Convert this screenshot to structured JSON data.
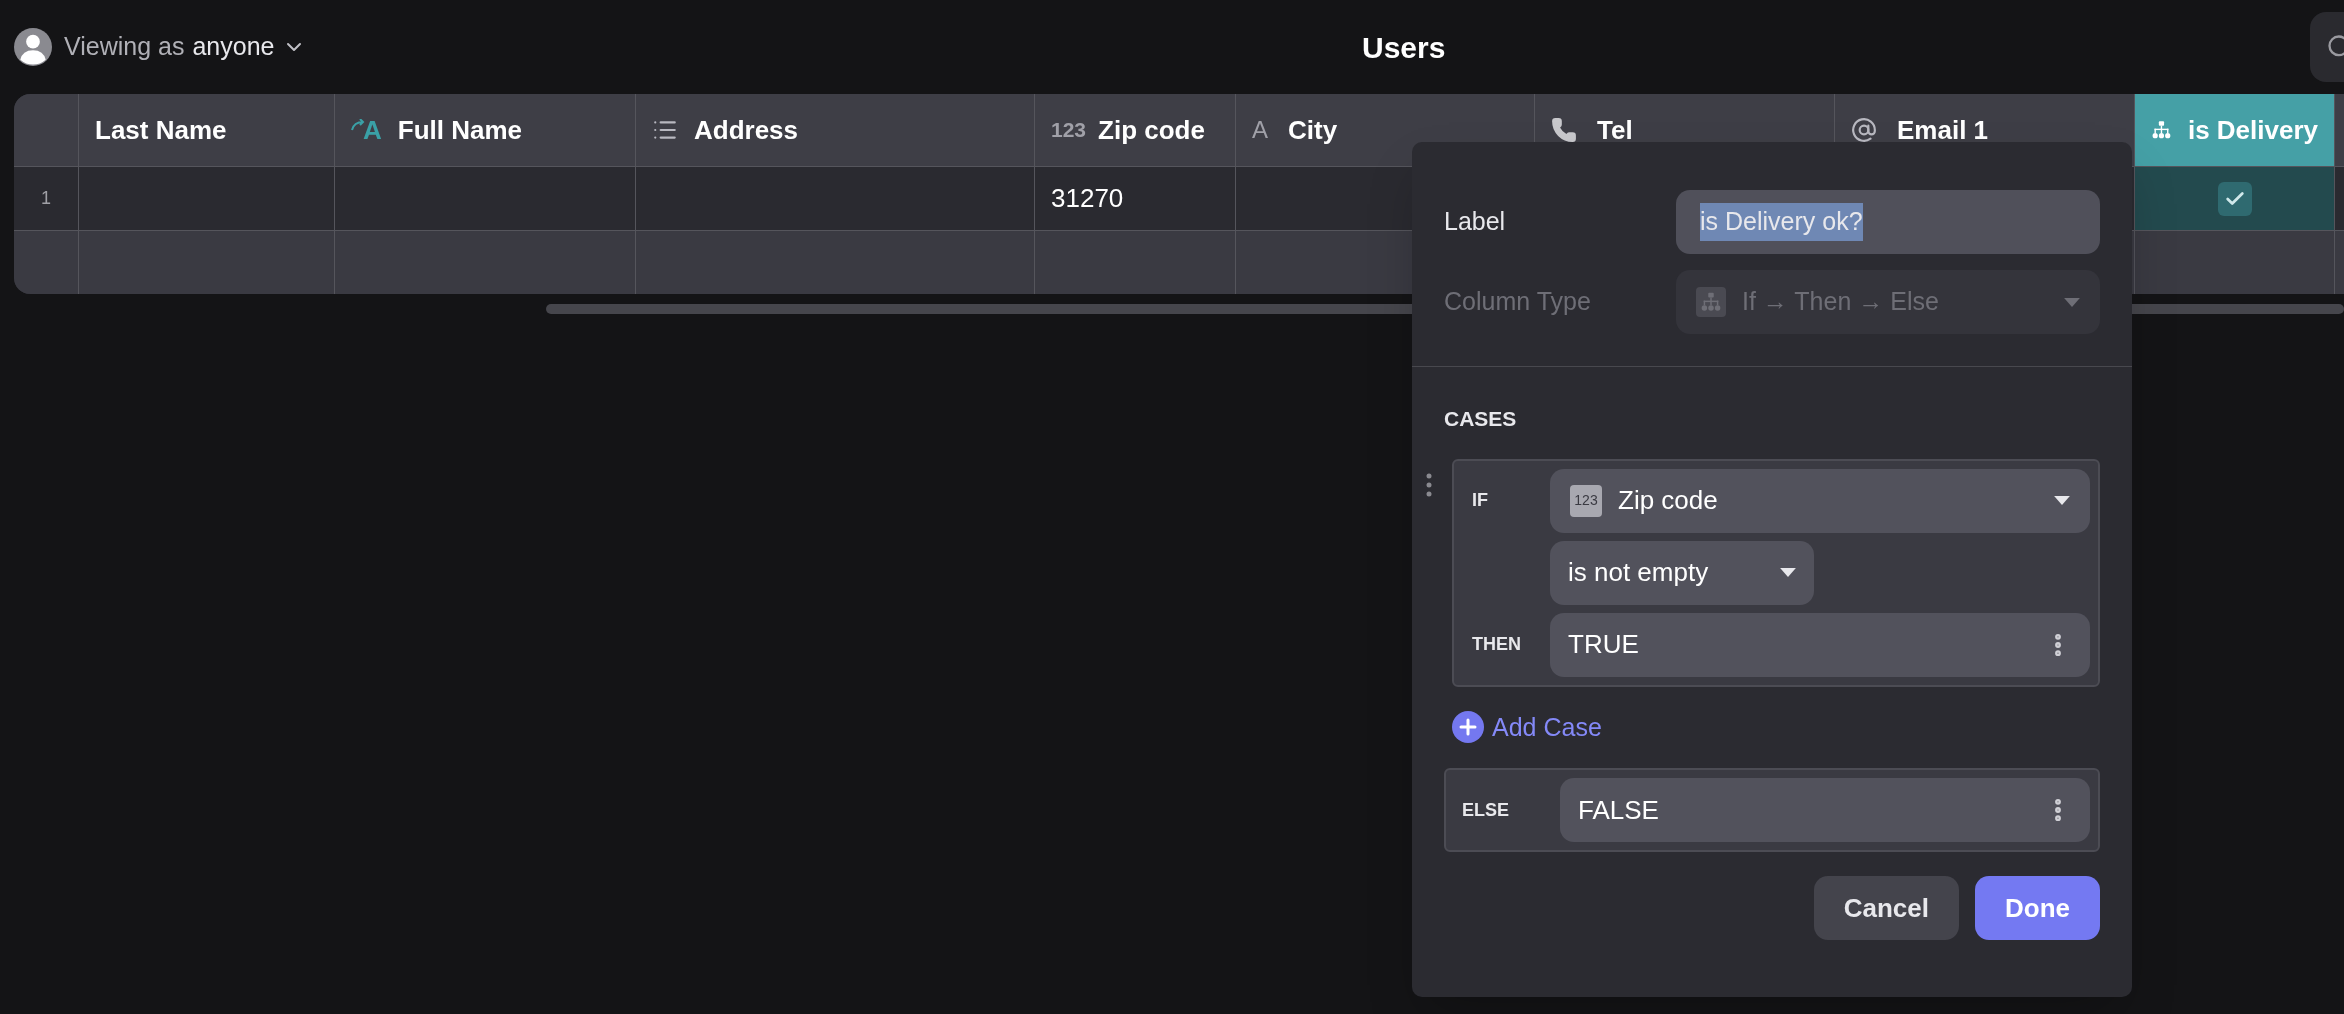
{
  "header": {
    "viewer_prefix": "Viewing as",
    "viewer": "anyone",
    "title": "Users"
  },
  "table": {
    "columns": [
      {
        "label": "Last Name",
        "kind": "plain",
        "selected": false
      },
      {
        "label": "Full Name",
        "kind": "formula",
        "icon_text": "A",
        "selected": false
      },
      {
        "label": "Address",
        "kind": "list",
        "selected": false
      },
      {
        "label": "Zip code",
        "kind": "number",
        "icon_text": "123",
        "selected": false
      },
      {
        "label": "City",
        "kind": "text",
        "icon_text": "A",
        "selected": false
      },
      {
        "label": "Tel",
        "kind": "phone",
        "selected": false
      },
      {
        "label": "Email 1",
        "kind": "email",
        "selected": false
      },
      {
        "label": "is Delivery",
        "kind": "ifthen",
        "selected": true
      }
    ],
    "rows": [
      {
        "number": "1",
        "cells": [
          {},
          {},
          {},
          {
            "text": "31270"
          },
          {},
          {},
          {},
          {
            "checked": true
          }
        ]
      }
    ]
  },
  "editor": {
    "label_caption": "Label",
    "label_value": "is Delivery ok?",
    "type_caption": "Column Type",
    "type_value": "If → Then → Else",
    "type_disabled": true,
    "cases_heading": "CASES",
    "cases": [
      {
        "if_label": "IF",
        "field_icon_text": "123",
        "field": "Zip code",
        "operator": "is not empty",
        "then_label": "THEN",
        "then_value": "TRUE"
      }
    ],
    "add_case": "Add Case",
    "else_label": "ELSE",
    "else_value": "FALSE",
    "buttons": [
      {
        "label": "Cancel",
        "kind": "secondary"
      },
      {
        "label": "Done",
        "kind": "primary"
      }
    ]
  }
}
